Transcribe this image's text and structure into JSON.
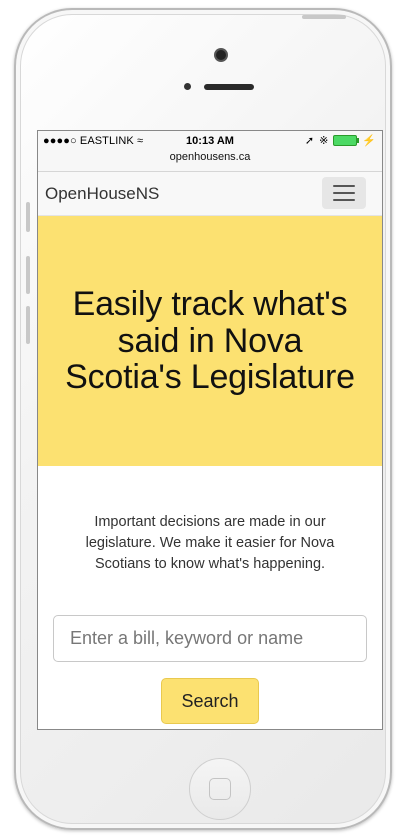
{
  "status_bar": {
    "carrier": "●●●●○ EASTLINK",
    "time": "10:13 AM",
    "url": "openhousens.ca",
    "battery_color": "#4cd964"
  },
  "navbar": {
    "brand": "OpenHouseNS",
    "menu_icon": "hamburger-icon"
  },
  "hero": {
    "headline": "Easily track what's said in Nova Scotia's Legislature",
    "background": "#fce171"
  },
  "intro": {
    "text": "Important decisions are made in our legislature. We make it easier for Nova Scotians to know what's happening."
  },
  "search": {
    "placeholder": "Enter a bill, keyword or name",
    "button_label": "Search"
  }
}
